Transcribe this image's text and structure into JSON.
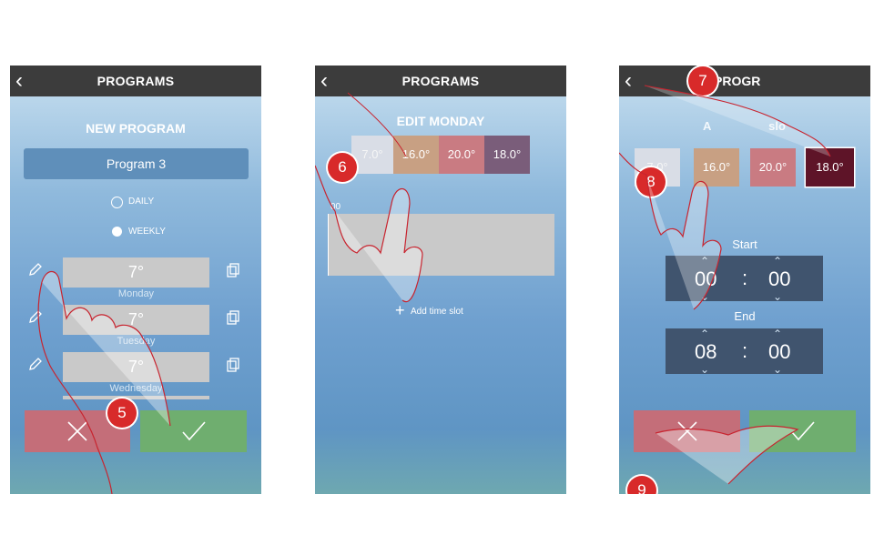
{
  "left": {
    "title": "PROGRAMS",
    "heading": "NEW PROGRAM",
    "program_name": "Program 3",
    "options": {
      "daily": "DAILY",
      "weekly": "WEEKLY"
    },
    "days": [
      {
        "temp": "7°",
        "label": "Monday"
      },
      {
        "temp": "7°",
        "label": "Tuesday"
      },
      {
        "temp": "7°",
        "label": "Wednesday"
      }
    ],
    "step": "5"
  },
  "middle": {
    "title": "PROGRAMS",
    "heading": "EDIT MONDAY",
    "temps": [
      "7.0°",
      "16.0°",
      "20.0°",
      "18.0°"
    ],
    "timeline_label": "00",
    "add_slot": "Add time slot",
    "step": "6"
  },
  "right": {
    "title": "PROGR",
    "heading_part1": "A",
    "heading_part2": "slo",
    "temps": [
      "7.0°",
      "16.0°",
      "20.0°",
      "18.0°"
    ],
    "start_label": "Start",
    "start_hour": "00",
    "start_min": "00",
    "end_label": "End",
    "end_hour": "08",
    "end_min": "00",
    "separator": ":",
    "steps": [
      "7",
      "8",
      "9"
    ]
  },
  "colors": {
    "temp1": "#d9dde6",
    "temp2": "#c8a083",
    "temp3": "#c97b82",
    "temp4": "#7a5d7a",
    "temp4_selected": "#5e1428",
    "cancel": "#c46e79",
    "confirm": "#6fae6f"
  }
}
